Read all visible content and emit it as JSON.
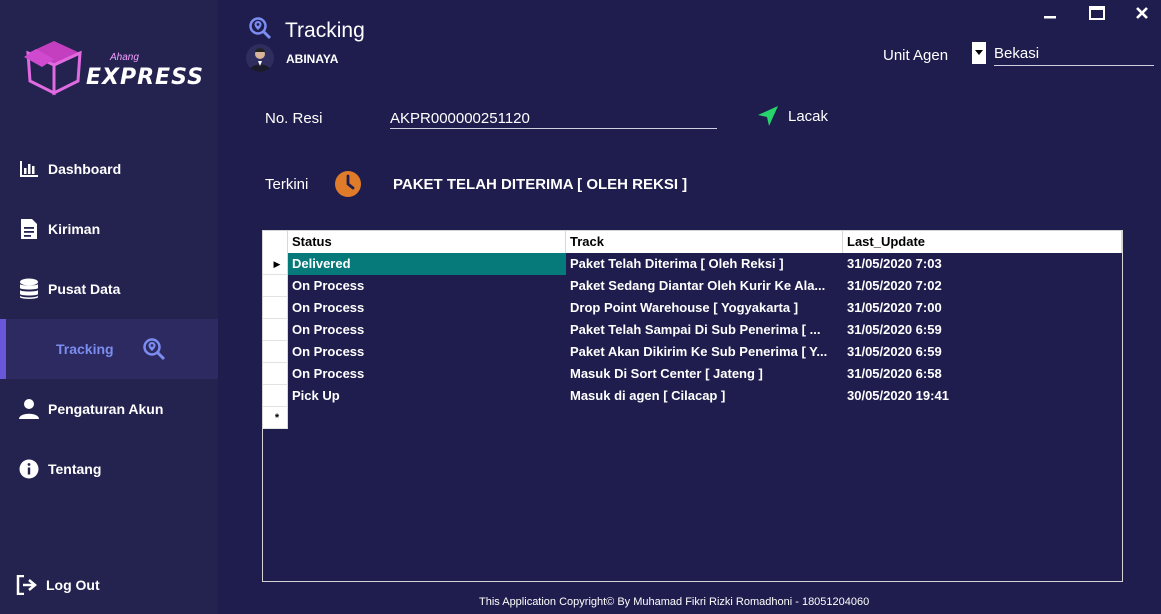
{
  "app": {
    "brand_script": "Ahang",
    "brand_name": "EXPRESS",
    "page_title": "Tracking",
    "user_name": "ABINAYA"
  },
  "sidebar": {
    "items": [
      {
        "label": "Dashboard",
        "icon": "bar-chart-icon"
      },
      {
        "label": "Kiriman",
        "icon": "document-icon"
      },
      {
        "label": "Pusat Data",
        "icon": "database-icon"
      },
      {
        "label": "Tracking",
        "icon": "search-location-icon"
      },
      {
        "label": "Pengaturan Akun",
        "icon": "user-icon"
      },
      {
        "label": "Tentang",
        "icon": "info-icon"
      }
    ],
    "logout_label": "Log Out"
  },
  "header": {
    "unit_label": "Unit Agen",
    "unit_value": "Bekasi"
  },
  "resi": {
    "label": "No. Resi",
    "value": "AKPR000000251120",
    "lacak_label": "Lacak"
  },
  "terkini": {
    "label": "Terkini",
    "value": "PAKET TELAH DITERIMA [ OLEH REKSI ]"
  },
  "grid": {
    "columns": [
      "Status",
      "Track",
      "Last_Update"
    ],
    "rows": [
      {
        "status": "Delivered",
        "track": "Paket Telah Diterima [ Oleh Reksi ]",
        "last_update": "31/05/2020 7:03"
      },
      {
        "status": "On Process",
        "track": "Paket Sedang Diantar Oleh Kurir Ke Ala...",
        "last_update": "31/05/2020 7:02"
      },
      {
        "status": "On Process",
        "track": "Drop Point Warehouse [ Yogyakarta ]",
        "last_update": "31/05/2020 7:00"
      },
      {
        "status": "On Process",
        "track": "Paket Telah Sampai Di Sub Penerima [ ...",
        "last_update": "31/05/2020 6:59"
      },
      {
        "status": "On Process",
        "track": "Paket Akan Dikirim Ke Sub Penerima [ Y...",
        "last_update": "31/05/2020 6:59"
      },
      {
        "status": "On Process",
        "track": "Masuk Di Sort Center [ Jateng ]",
        "last_update": "31/05/2020 6:58"
      },
      {
        "status": "Pick Up",
        "track": "Masuk di agen [ Cilacap ]",
        "last_update": "30/05/2020 19:41"
      }
    ]
  },
  "footer": {
    "copyright": "This Application Copyright© By Muhamad Fikri Rizki Romadhoni - 18051204060"
  },
  "colors": {
    "background": "#1f1d4d",
    "sidebar": "#24224f",
    "accent": "#6a56d8",
    "selected_cell": "#067a7a",
    "clock": "#e07b2a",
    "lacak_arrow": "#27d36b"
  }
}
